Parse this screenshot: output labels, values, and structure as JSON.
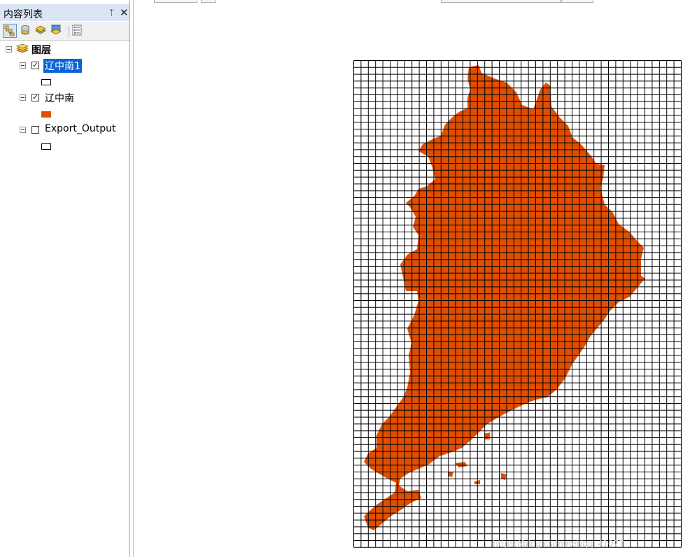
{
  "toc": {
    "title": "内容列表",
    "pin_glyph": "ᛘ",
    "close_glyph": "✕",
    "toolbar_icons": [
      "list-by-drawing-order-icon",
      "list-by-source-icon",
      "list-by-visibility-icon",
      "list-by-selection-icon",
      "options-icon"
    ],
    "root": {
      "label": "图层"
    },
    "layers": [
      {
        "label": "辽中南1",
        "checked": true,
        "selected": true,
        "symbol": "hollow-rectangle"
      },
      {
        "label": "辽中南",
        "checked": true,
        "selected": false,
        "symbol": "filled-rectangle"
      },
      {
        "label": "Export_Output",
        "checked": false,
        "selected": false,
        "symbol": "hollow-rectangle"
      }
    ]
  },
  "map": {
    "fill_color": "#e04e00",
    "grid_color": "#000000",
    "watermark": "https://blog.csdn.net/qq_41077"
  }
}
